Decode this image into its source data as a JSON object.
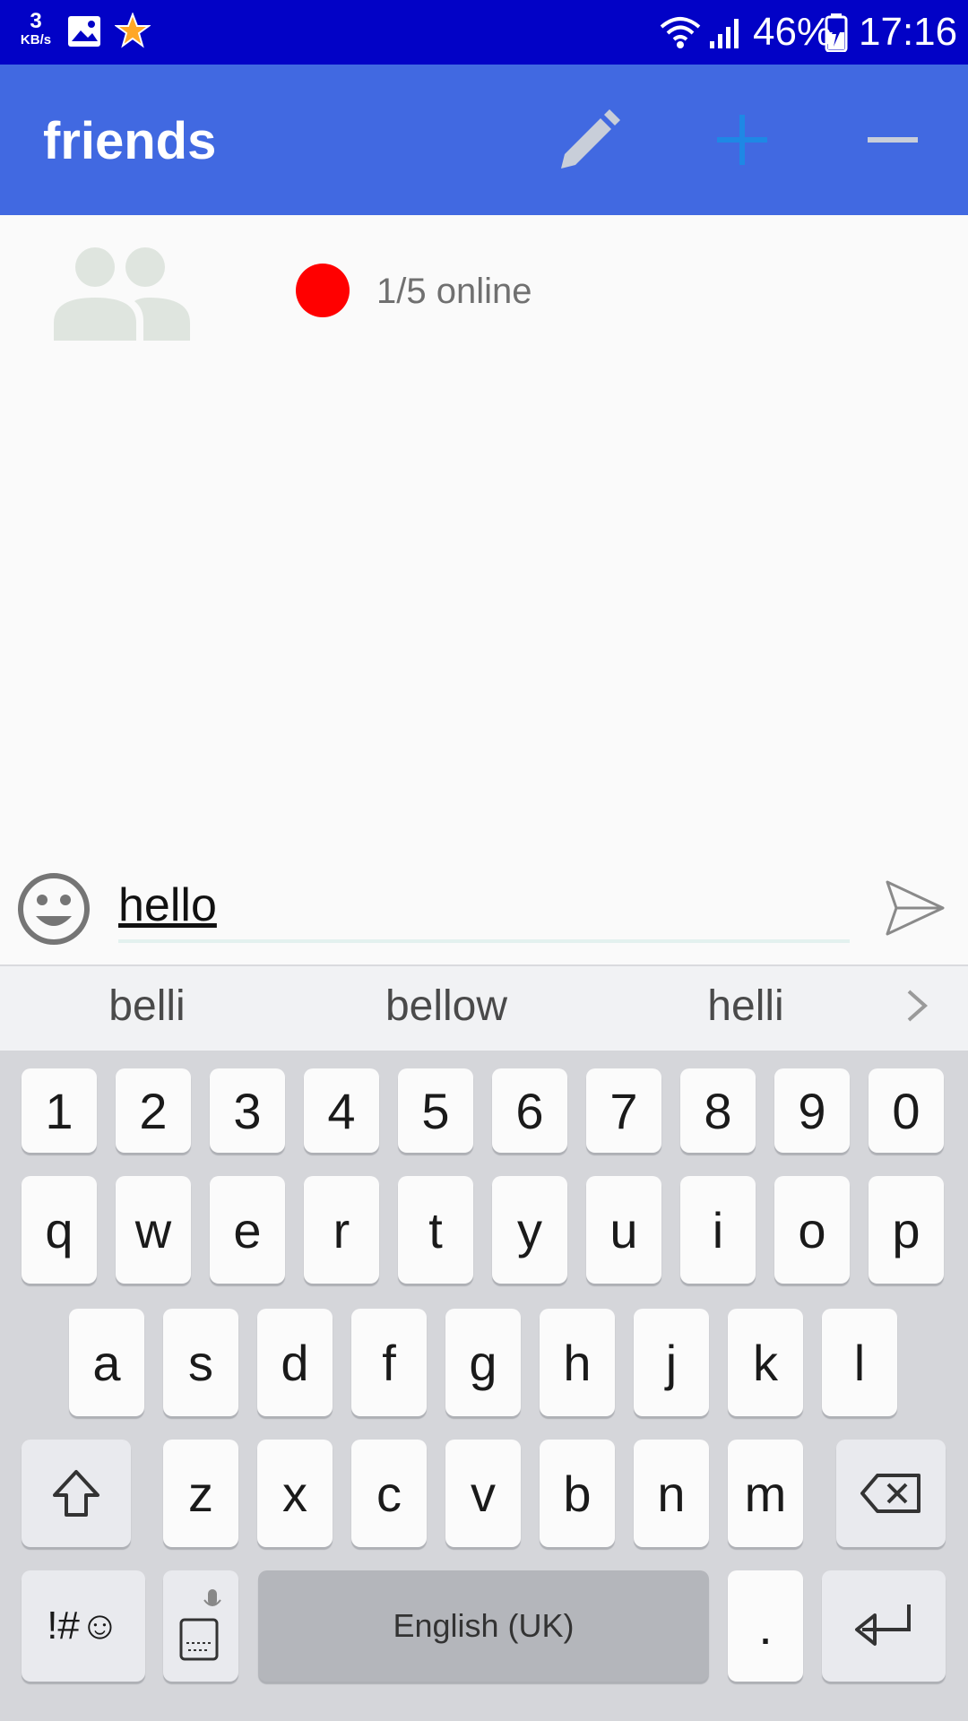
{
  "status_bar": {
    "net_speed_value": "3",
    "net_speed_unit": "KB/s",
    "battery_percent": "46%",
    "time": "17:16",
    "icons": [
      "image-icon",
      "star-icon",
      "wifi-icon",
      "signal-icon",
      "battery-charging-icon"
    ]
  },
  "app_bar": {
    "title": "friends",
    "actions": [
      "edit-icon",
      "add-icon",
      "remove-icon"
    ],
    "color": "#4169e1"
  },
  "group": {
    "status_color": "#ff0000",
    "online_text": "1/5 online"
  },
  "composer": {
    "value": "hello"
  },
  "keyboard": {
    "suggestions": [
      "belli",
      "bellow",
      "helli"
    ],
    "row_numbers": [
      "1",
      "2",
      "3",
      "4",
      "5",
      "6",
      "7",
      "8",
      "9",
      "0"
    ],
    "row_1": [
      "q",
      "w",
      "e",
      "r",
      "t",
      "y",
      "u",
      "i",
      "o",
      "p"
    ],
    "row_2": [
      "a",
      "s",
      "d",
      "f",
      "g",
      "h",
      "j",
      "k",
      "l"
    ],
    "row_3": [
      "z",
      "x",
      "c",
      "v",
      "b",
      "n",
      "m"
    ],
    "symbols_label": "!#☺",
    "space_label": "English (UK)",
    "period_label": "."
  }
}
